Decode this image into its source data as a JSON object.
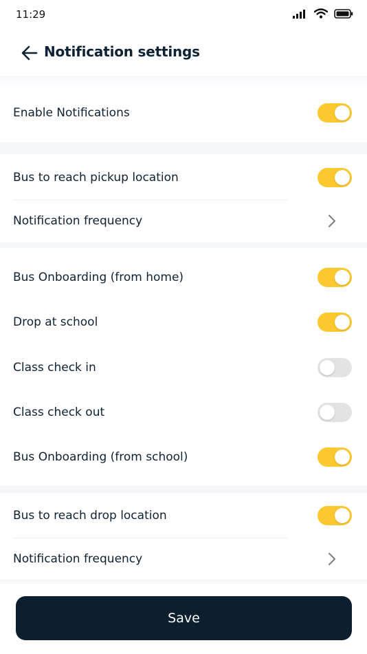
{
  "status_bar": {
    "time": "11:29",
    "icons": [
      "signal-icon",
      "wifi-icon",
      "battery-icon"
    ]
  },
  "header": {
    "back_icon": "arrow-left-icon",
    "title": "Notification settings"
  },
  "colors": {
    "toggle_on": "#fcc82f",
    "toggle_off": "#e3e3e3",
    "primary_dark": "#0b1f2e",
    "section_divider": "#f5f6fa"
  },
  "settings": {
    "enable_notifications": {
      "label": "Enable Notifications",
      "enabled": true
    },
    "pickup": {
      "label": "Bus to reach pickup location",
      "enabled": true,
      "frequency_label": "Notification frequency"
    },
    "events": [
      {
        "label": "Bus Onboarding (from home)",
        "enabled": true
      },
      {
        "label": "Drop at school",
        "enabled": true
      },
      {
        "label": "Class check in",
        "enabled": false
      },
      {
        "label": "Class check out",
        "enabled": false
      },
      {
        "label": "Bus Onboarding (from school)",
        "enabled": true
      }
    ],
    "drop": {
      "label": "Bus to reach drop location",
      "enabled": true,
      "frequency_label": "Notification frequency"
    }
  },
  "footer": {
    "save_label": "Save"
  }
}
